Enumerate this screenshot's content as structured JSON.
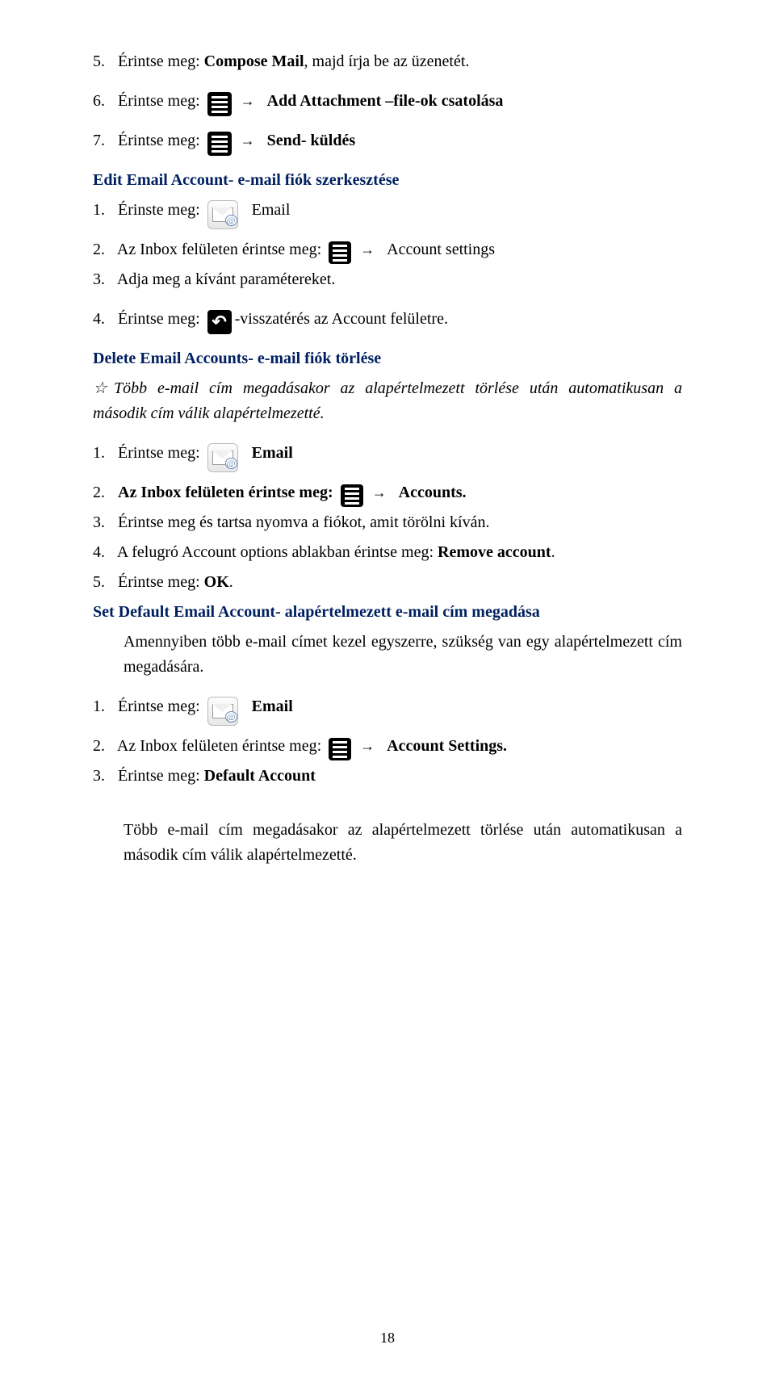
{
  "top_steps": {
    "s5": {
      "num": "5.",
      "pre": "Érintse meg: ",
      "bold": "Compose Mail",
      "post": ", majd írja be az üzenetét."
    },
    "s6": {
      "num": "6.",
      "pre": "Érintse meg:",
      "arrow": "→",
      "after": "Add Attachment –file-ok csatolása"
    },
    "s7": {
      "num": "7.",
      "pre": "Érintse meg:",
      "arrow": "→",
      "after": "Send- küldés"
    }
  },
  "sec_edit": {
    "title": "Edit Email Account- e-mail fiók szerkesztése",
    "s1": {
      "num": "1.",
      "pre": "Érinste meg:",
      "after": "Email"
    },
    "s2": {
      "num": "2.",
      "pre": "Az Inbox felületen érintse meg:",
      "arrow": "→",
      "after": "Account settings"
    },
    "s3": {
      "num": "3.",
      "text": "Adja meg a kívánt paramétereket."
    },
    "s4": {
      "num": "4.",
      "pre": "Érintse meg:",
      "after": "-visszatérés az Account felületre."
    }
  },
  "sec_delete": {
    "title": "Delete Email Accounts- e-mail fiók törlése",
    "star": "☆",
    "note": "Több e-mail cím megadásakor az alapértelmezett törlése után automatikusan a második cím válik alapértelmezetté.",
    "s1": {
      "num": "1.",
      "pre": "Érintse meg:",
      "after": "Email"
    },
    "s2": {
      "num": "2.",
      "pre": "Az Inbox felületen érintse meg:",
      "arrow": "→",
      "after": "Accounts."
    },
    "s3": {
      "num": "3.",
      "text": "Érintse meg és tartsa nyomva a fiókot, amit törölni kíván."
    },
    "s4": {
      "num": "4.",
      "pre": "A felugró Account options ablakban érintse meg: ",
      "bold": "Remove account",
      "post": "."
    },
    "s5": {
      "num": "5.",
      "pre": "Érintse meg: ",
      "bold": "OK",
      "post": "."
    }
  },
  "sec_default": {
    "title": "Set Default Email Account- alapértelmezett e-mail cím megadása",
    "intro": "Amennyiben több e-mail címet kezel egyszerre, szükség van egy alapértelmezett cím megadására.",
    "s1": {
      "num": "1.",
      "pre": "Érintse meg:",
      "after": "Email"
    },
    "s2": {
      "num": "2.",
      "pre": "Az Inbox felületen érintse meg:",
      "arrow": "→",
      "after": "Account Settings."
    },
    "s3": {
      "num": "3.",
      "pre": "Érintse meg: ",
      "bold": "Default Account"
    },
    "closing": "Több e-mail cím megadásakor az alapértelmezett törlése után automatikusan a második cím válik alapértelmezetté."
  },
  "page_number": "18"
}
